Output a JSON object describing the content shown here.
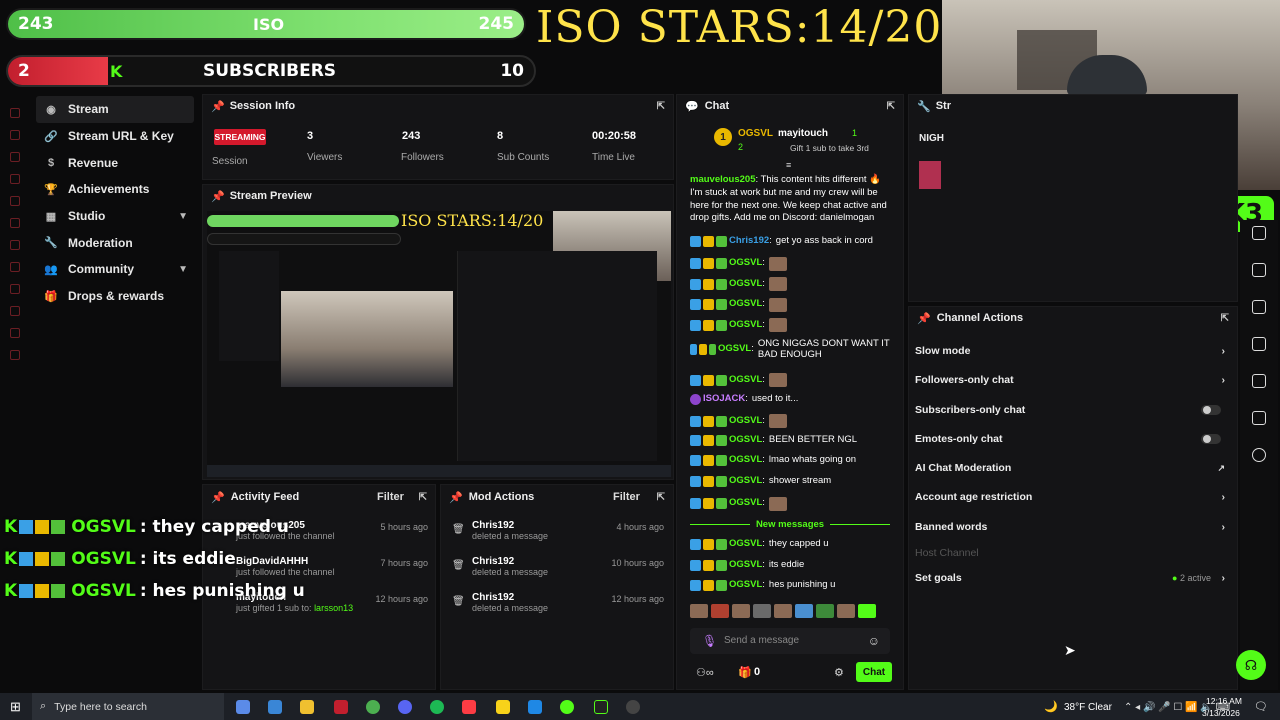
{
  "overlay": {
    "iso_bar": {
      "left": "243",
      "label": "ISO",
      "right": "245"
    },
    "sub_bar": {
      "left": "2",
      "label": "SUBSCRIBERS",
      "right": "10"
    },
    "iso_stars": "ISO STARS:14/20",
    "webcam_badge": "3",
    "chat_lines": [
      {
        "user": "OGSVL",
        "text": ": they capped u"
      },
      {
        "user": "OGSVL",
        "text": ": its eddie"
      },
      {
        "user": "OGSVL",
        "text": ": hes punishing u"
      }
    ]
  },
  "nav": {
    "items": [
      {
        "label": "Stream",
        "icon": "broadcast-icon"
      },
      {
        "label": "Stream URL & Key",
        "icon": "link-icon"
      },
      {
        "label": "Revenue",
        "icon": "dollar-icon"
      },
      {
        "label": "Achievements",
        "icon": "trophy-icon"
      },
      {
        "label": "Studio",
        "icon": "studio-icon"
      },
      {
        "label": "Moderation",
        "icon": "wrench-icon"
      },
      {
        "label": "Community",
        "icon": "users-icon"
      },
      {
        "label": "Drops & rewards",
        "icon": "gift-icon"
      }
    ]
  },
  "session": {
    "title": "Session Info",
    "status": "STREAMING",
    "status_label": "Session",
    "viewers": "3",
    "viewers_label": "Viewers",
    "followers": "243",
    "followers_label": "Followers",
    "subs": "8",
    "subs_label": "Sub Counts",
    "time": "00:20:58",
    "time_label": "Time Live"
  },
  "preview": {
    "title": "Stream Preview"
  },
  "activity": {
    "title": "Activity Feed",
    "filter": "Filter",
    "items": [
      {
        "name": "mauvelous205",
        "desc": "just followed the channel",
        "time": "5 hours ago"
      },
      {
        "name": "BigDavidAHHH",
        "desc": "just followed the channel",
        "time": "7 hours ago"
      },
      {
        "name": "mayitouch",
        "desc": "just gifted 1 sub to:",
        "target": "larsson13",
        "time": "12 hours ago"
      }
    ]
  },
  "mod": {
    "title": "Mod Actions",
    "filter": "Filter",
    "items": [
      {
        "name": "Chris192",
        "desc": "deleted a message",
        "time": "4 hours ago"
      },
      {
        "name": "Chris192",
        "desc": "deleted a message",
        "time": "10 hours ago"
      },
      {
        "name": "Chris192",
        "desc": "deleted a message",
        "time": "12 hours ago"
      }
    ]
  },
  "chat": {
    "title": "Chat",
    "pinned": {
      "from": "OGSVL",
      "from_count": "2",
      "to": "mayitouch",
      "to_count": "1",
      "text": "Gift 1 sub to take 3rd"
    },
    "first_msg": {
      "user": "mauvelous205",
      "text": "This content hits different 🔥 I'm stuck at work but me and my crew will be here for the next one. We keep chat active and drop gifts. Add me on Discord: danielmogan"
    },
    "messages": [
      {
        "user": "Chris192",
        "text": "get yo ass back in cord",
        "color": "#3aa0e6"
      },
      {
        "user": "OGSVL",
        "text": "",
        "thumb": true
      },
      {
        "user": "OGSVL",
        "text": "",
        "thumb": true
      },
      {
        "user": "OGSVL",
        "text": "",
        "thumb": true
      },
      {
        "user": "OGSVL",
        "text": "",
        "thumb": true
      },
      {
        "user": "OGSVL",
        "text": "ONG NIGGAS DONT WANT IT BAD ENOUGH"
      },
      {
        "user": "OGSVL",
        "text": "",
        "thumb": true
      },
      {
        "user": "ISOJACK",
        "text": "used to it...",
        "color": "#c77dff"
      },
      {
        "user": "OGSVL",
        "text": "",
        "thumb": true
      },
      {
        "user": "OGSVL",
        "text": "BEEN BETTER NGL"
      },
      {
        "user": "OGSVL",
        "text": "lmao whats going on"
      },
      {
        "user": "OGSVL",
        "text": "shower stream"
      },
      {
        "user": "OGSVL",
        "text": "",
        "thumb": true
      }
    ],
    "new_messages": "New messages",
    "new": [
      {
        "user": "OGSVL",
        "text": "they capped u"
      },
      {
        "user": "OGSVL",
        "text": "its eddie"
      },
      {
        "user": "OGSVL",
        "text": "hes punishing u"
      }
    ],
    "placeholder": "Send a message",
    "count": "0",
    "send": "Chat"
  },
  "partial_panel": {
    "title": "Str",
    "text": "NIGH"
  },
  "channel_actions": {
    "title": "Channel Actions",
    "rows": [
      {
        "label": "Slow mode",
        "kind": "arrow"
      },
      {
        "label": "Followers-only chat",
        "kind": "arrow"
      },
      {
        "label": "Subscribers-only chat",
        "kind": "toggle"
      },
      {
        "label": "Emotes-only chat",
        "kind": "toggle"
      },
      {
        "label": "AI Chat Moderation",
        "kind": "external"
      },
      {
        "label": "Account age restriction",
        "kind": "arrow"
      },
      {
        "label": "Banned words",
        "kind": "arrow"
      },
      {
        "label": "Host Channel",
        "kind": "disabled"
      },
      {
        "label": "Set goals",
        "kind": "arrow",
        "extra": "2 active"
      }
    ]
  },
  "taskbar": {
    "search": "Type here to search",
    "weather": "38°F  Clear",
    "time": "12:16 AM",
    "date": "3/13/2026"
  }
}
